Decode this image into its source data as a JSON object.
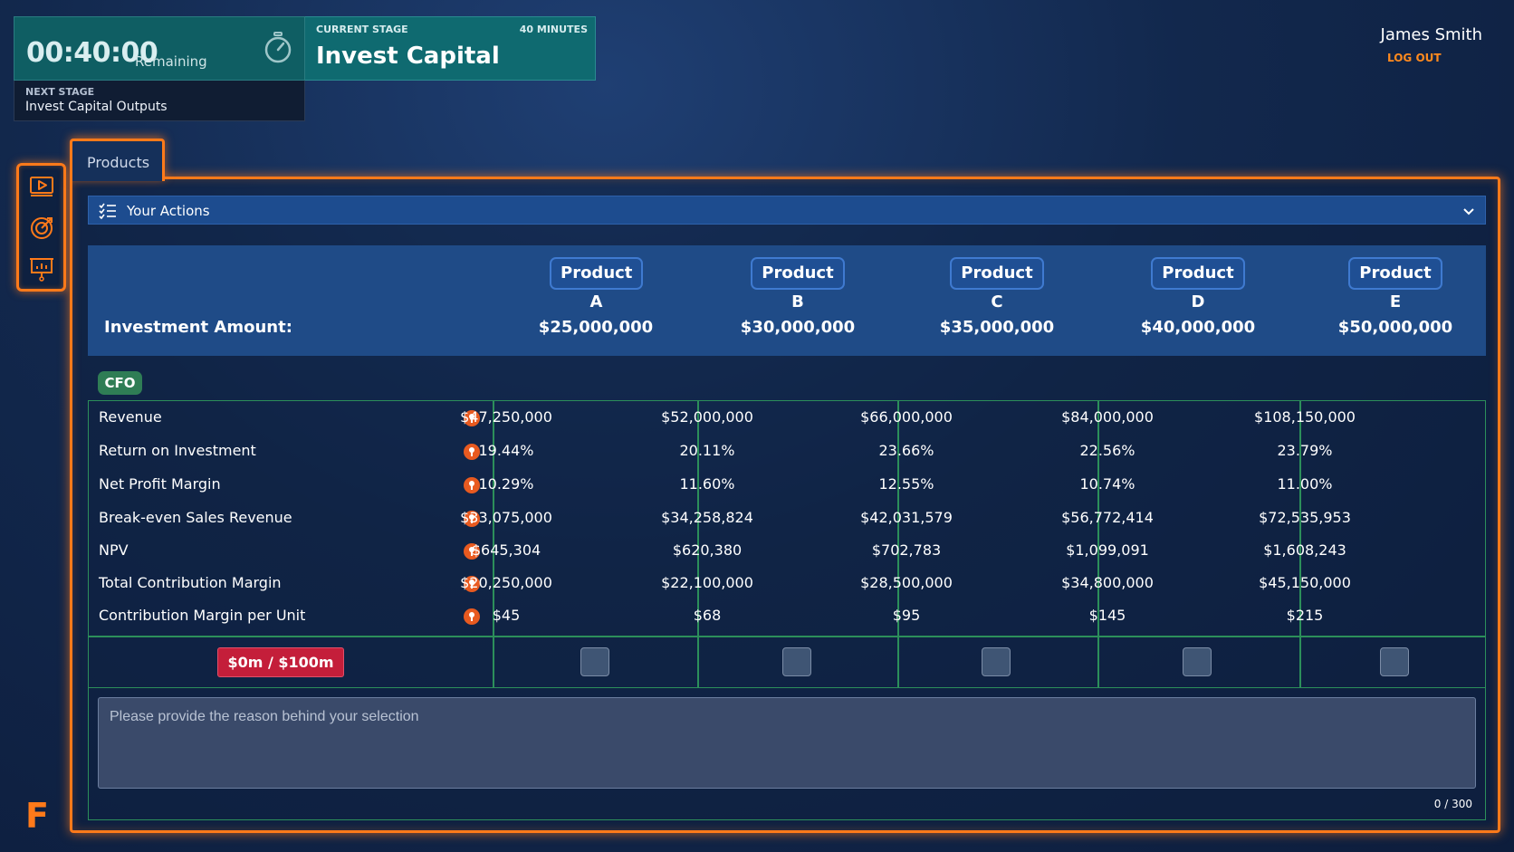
{
  "timer": {
    "value": "00:40:00",
    "remaining_label": "Remaining",
    "icon": "stopwatch-icon"
  },
  "stage": {
    "current_label": "CURRENT STAGE",
    "minutes": "40 MINUTES",
    "title": "Invest Capital",
    "next_label": "NEXT STAGE",
    "next_title": "Invest Capital Outputs"
  },
  "user": {
    "name": "James Smith",
    "logout_label": "LOG OUT"
  },
  "sidebar": {
    "items": [
      {
        "icon": "video-play-icon"
      },
      {
        "icon": "target-icon"
      },
      {
        "icon": "presentation-icon"
      }
    ]
  },
  "brand": {
    "logo_letter": "F"
  },
  "tabs": [
    {
      "label": "Products"
    }
  ],
  "actions_bar": {
    "label": "Your Actions"
  },
  "products": [
    "Product A",
    "Product B",
    "Product C",
    "Product D",
    "Product E"
  ],
  "investment": {
    "label": "Investment Amount:",
    "amounts": [
      "$25,000,000",
      "$30,000,000",
      "$35,000,000",
      "$40,000,000",
      "$50,000,000"
    ]
  },
  "section_badge": "CFO",
  "metrics": [
    {
      "label": "Revenue",
      "values": [
        "$47,250,000",
        "$52,000,000",
        "$66,000,000",
        "$84,000,000",
        "$108,150,000"
      ]
    },
    {
      "label": "Return on Investment",
      "values": [
        "19.44%",
        "20.11%",
        "23.66%",
        "22.56%",
        "23.79%"
      ]
    },
    {
      "label": "Net Profit Margin",
      "values": [
        "10.29%",
        "11.60%",
        "12.55%",
        "10.74%",
        "11.00%"
      ]
    },
    {
      "label": "Break-even Sales Revenue",
      "values": [
        "$33,075,000",
        "$34,258,824",
        "$42,031,579",
        "$56,772,414",
        "$72,535,953"
      ]
    },
    {
      "label": "NPV",
      "values": [
        "$645,304",
        "$620,380",
        "$702,783",
        "$1,099,091",
        "$1,608,243"
      ]
    },
    {
      "label": "Total Contribution Margin",
      "values": [
        "$20,250,000",
        "$22,100,000",
        "$28,500,000",
        "$34,800,000",
        "$45,150,000"
      ]
    },
    {
      "label": "Contribution Margin per Unit",
      "values": [
        "$45",
        "$68",
        "$95",
        "$145",
        "$215"
      ]
    }
  ],
  "budget_badge": "$0m / $100m",
  "selections": [
    false,
    false,
    false,
    false,
    false
  ],
  "reason": {
    "placeholder": "Please provide the reason behind your selection",
    "value": "",
    "char_count": "0 / 300"
  },
  "colors": {
    "accent_orange": "#ff7a1a",
    "table_border_green": "#2c8f5a",
    "budget_red": "#c41e3a",
    "info_orange": "#e85a20",
    "stage_teal": "#0f6a70"
  }
}
